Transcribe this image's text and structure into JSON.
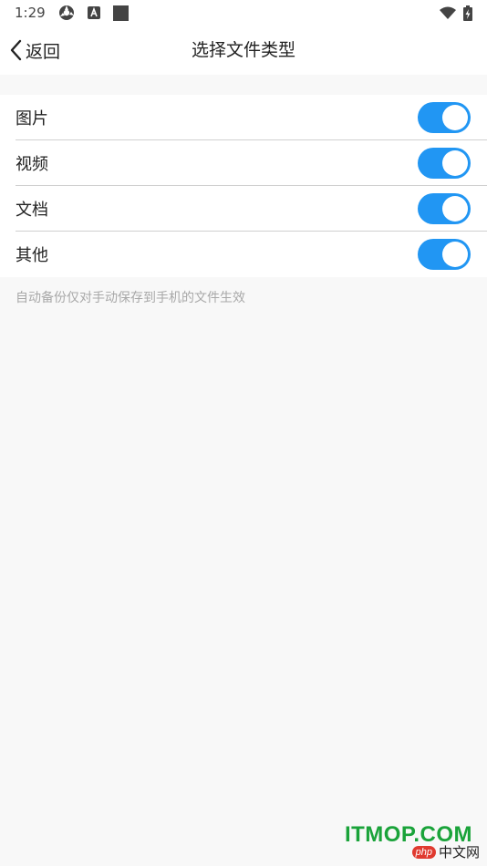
{
  "status_bar": {
    "time": "1:29",
    "icons": [
      "sync-icon",
      "a-badge-icon",
      "square-icon",
      "wifi-icon",
      "battery-charging-icon"
    ]
  },
  "nav": {
    "back_label": "返回",
    "title": "选择文件类型"
  },
  "settings": {
    "items": [
      {
        "label": "图片",
        "enabled": true
      },
      {
        "label": "视频",
        "enabled": true
      },
      {
        "label": "文档",
        "enabled": true
      },
      {
        "label": "其他",
        "enabled": true
      }
    ],
    "hint": "自动备份仅对手动保存到手机的文件生效"
  },
  "watermark": {
    "brand": "ITMOP.COM",
    "php_tag": "php",
    "site_label": "中文网"
  },
  "colors": {
    "accent": "#2196f3",
    "background": "#f8f8f8",
    "watermark_green": "#1aa33a"
  }
}
